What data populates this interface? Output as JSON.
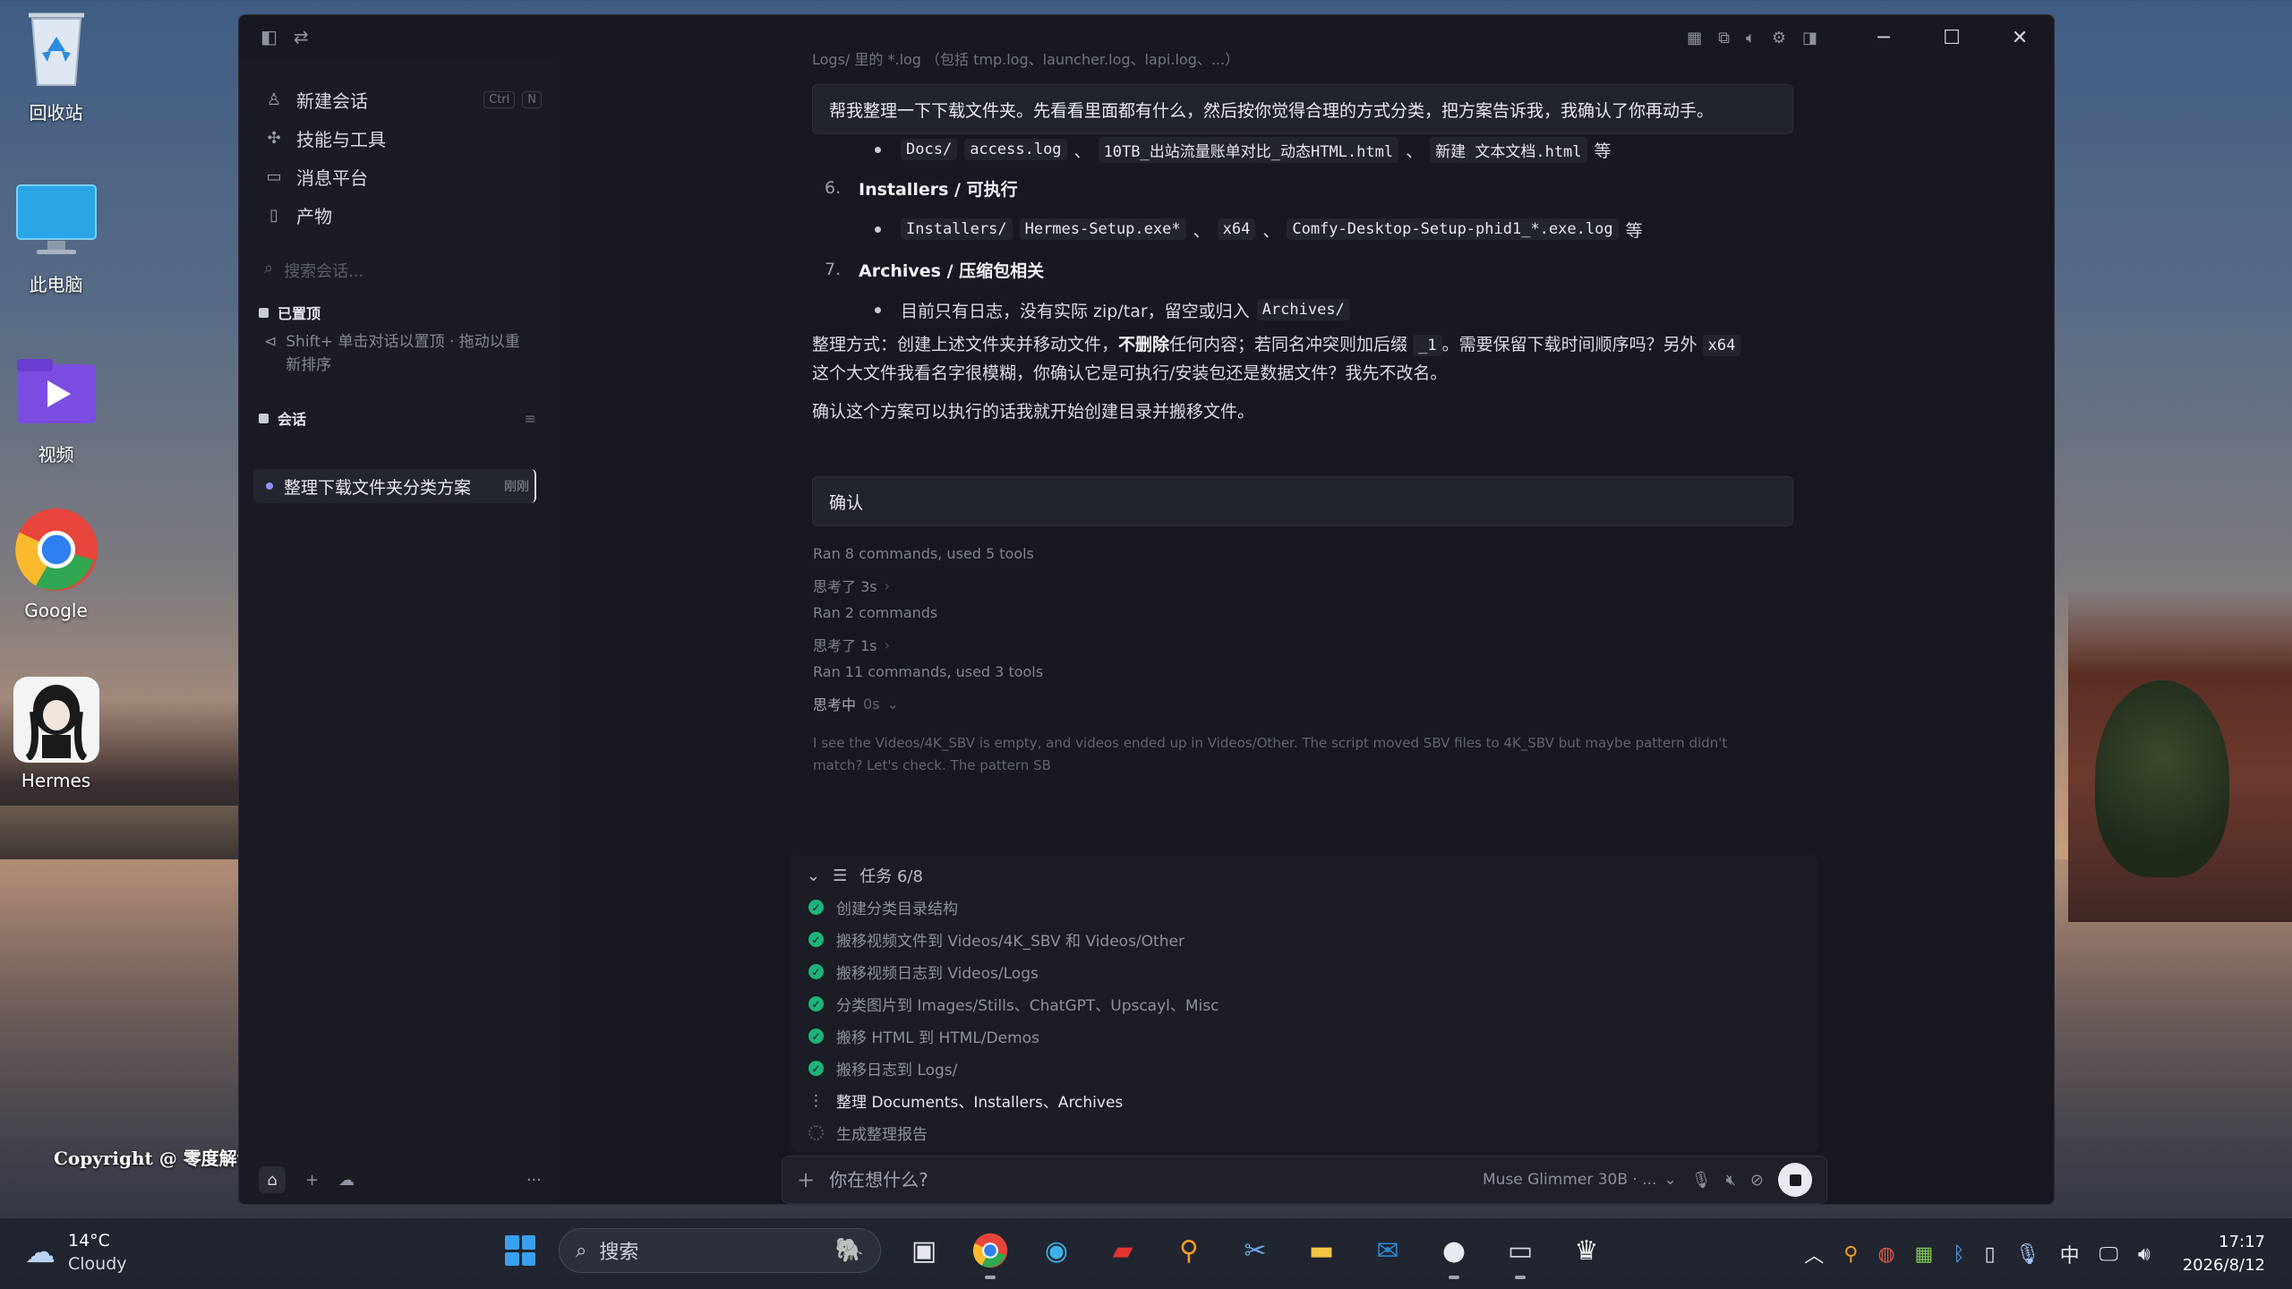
{
  "desktop": {
    "icons": [
      {
        "label": "回收站"
      },
      {
        "label": "此电脑"
      },
      {
        "label": "视频"
      },
      {
        "label": "Google"
      },
      {
        "label": "Hermes"
      }
    ],
    "copyright": "Copyright @ 零度解说"
  },
  "sidebar": {
    "items": [
      {
        "label": "新建会话",
        "icon": "user-icon",
        "shortcut": [
          "Ctrl",
          "N"
        ]
      },
      {
        "label": "技能与工具",
        "icon": "puzzle-icon"
      },
      {
        "label": "消息平台",
        "icon": "chat-icon"
      },
      {
        "label": "产物",
        "icon": "document-icon"
      }
    ],
    "search_placeholder": "搜索会话...",
    "pinned_heading": "已置顶",
    "pinned_hint": "Shift+ 单击对话以置顶 · 拖动以重新排序",
    "conversations_heading": "会话",
    "active_conversation": {
      "title": "整理下载文件夹分类方案",
      "tag": "刚刚"
    }
  },
  "chat": {
    "truncated_top": "Logs/ 里的 *.log （包括 tmp.log、launcher.log、lapi.log、...）",
    "user_message": "帮我整理一下下载文件夹。先看看里面都有什么，然后按你觉得合理的方式分类，把方案告诉我，我确认了你再动手。",
    "docs_line": {
      "items": [
        "Docs/",
        "access.log",
        "10TB_出站流量账单对比_动态HTML.html",
        "新建 文本文档.html"
      ],
      "seps": [
        "、",
        "、"
      ],
      "suffix": "等"
    },
    "section6": {
      "num": "6.",
      "title": "Installers / 可执行"
    },
    "installers_line": {
      "items": [
        "Installers/",
        "Hermes-Setup.exe*",
        "x64",
        "Comfy-Desktop-Setup-phid1_*.exe.log"
      ],
      "seps": [
        "、",
        "、"
      ],
      "suffix": "等"
    },
    "section7": {
      "num": "7.",
      "title": "Archives / 压缩包相关"
    },
    "archives_line": {
      "text": "目前只有日志，没有实际 zip/tar，留空或归入",
      "code": "Archives/"
    },
    "method_para": {
      "prefix": "整理方式：创建上述文件夹并移动文件，",
      "bold": "不删除",
      "mid": "任何内容；若同名冲突则加后缀",
      "code1": "_1",
      "mid2": "。需要保留下载时间顺序吗？另外",
      "code2": "x64",
      "line2": "这个大文件我看名字很模糊，你确认它是可执行/安装包还是数据文件？我先不改名。"
    },
    "confirm_para": "确认这个方案可以执行的话我就开始创建目录并搬移文件。",
    "user_confirm": "确认",
    "tool_lines": [
      {
        "text": "Ran 8 commands, used 5 tools"
      },
      {
        "text": "思考了 3s",
        "chevron": "›"
      },
      {
        "text": "Ran 2 commands"
      },
      {
        "text": "思考了 1s",
        "chevron": "›"
      },
      {
        "text": "Ran 11 commands, used 3 tools"
      },
      {
        "text": "思考中",
        "extra": "0s",
        "chevron": "⌄"
      }
    ],
    "reasoning": "I see the Videos/4K_SBV is empty, and videos ended up in Videos/Other. The script moved SBV files to 4K_SBV but maybe pattern didn't match? Let's check. The pattern SB"
  },
  "tasks": {
    "header": "任务 6/8",
    "items": [
      {
        "label": "创建分类目录结构",
        "status": "done"
      },
      {
        "label": "搬移视频文件到 Videos/4K_SBV 和 Videos/Other",
        "status": "done"
      },
      {
        "label": "搬移视频日志到 Videos/Logs",
        "status": "done"
      },
      {
        "label": "分类图片到 Images/Stills、ChatGPT、Upscayl、Misc",
        "status": "done"
      },
      {
        "label": "搬移 HTML 到 HTML/Demos",
        "status": "done"
      },
      {
        "label": "搬移日志到 Logs/",
        "status": "done"
      },
      {
        "label": "整理 Documents、Installers、Archives",
        "status": "in_progress"
      },
      {
        "label": "生成整理报告",
        "status": "pending"
      }
    ]
  },
  "composer": {
    "placeholder": "你在想什么?",
    "model": "Muse Glimmer 30B · ...",
    "add_icon": "plus-icon",
    "stop_icon": "stop-icon"
  },
  "taskbar": {
    "weather": {
      "temp": "14°C",
      "condition": "Cloudy"
    },
    "search_placeholder": "搜索",
    "ime": "中",
    "time": "17:17",
    "date": "2026/8/12"
  },
  "colors": {
    "accent_green": "#1fb27a",
    "window_bg": "#181920",
    "sidebar_bg": "#1b1c23"
  }
}
